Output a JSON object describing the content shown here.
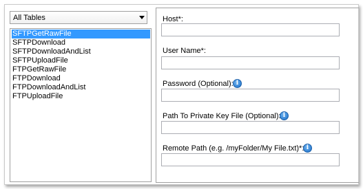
{
  "table_filter": {
    "selected": "All Tables"
  },
  "table_list": {
    "items": [
      {
        "label": "SFTPGetRawFile",
        "selected": true
      },
      {
        "label": "SFTPDownload",
        "selected": false
      },
      {
        "label": "SFTPDownloadAndList",
        "selected": false
      },
      {
        "label": "SFTPUploadFile",
        "selected": false
      },
      {
        "label": "FTPGetRawFile",
        "selected": false
      },
      {
        "label": "FTPDownload",
        "selected": false
      },
      {
        "label": "FTPDownloadAndList",
        "selected": false
      },
      {
        "label": "FTPUploadFile",
        "selected": false
      }
    ]
  },
  "form": {
    "host": {
      "label": "Host*:",
      "value": ""
    },
    "username": {
      "label": "User Name*:",
      "value": ""
    },
    "password": {
      "label": "Password (Optional):",
      "value": "",
      "info_icon": "info-icon"
    },
    "private_key": {
      "label": "Path To Private Key File (Optional):",
      "value": "",
      "info_icon": "info-icon"
    },
    "remote_path": {
      "label": "Remote Path (e.g. /myFolder/My File.txt)*:",
      "value": "",
      "info_icon": "info-icon"
    }
  },
  "colors": {
    "selection": "#3399ff",
    "info_icon": "#1a6ec8"
  }
}
